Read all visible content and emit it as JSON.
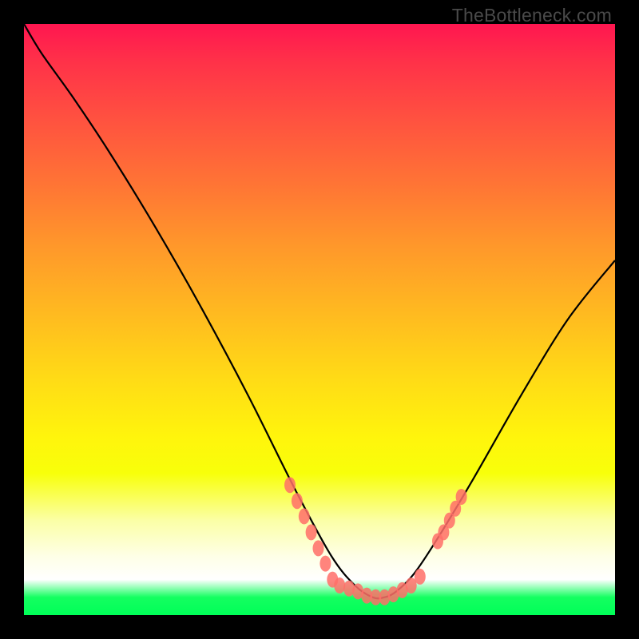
{
  "watermark_text": "TheBottleneck.com",
  "chart_data": {
    "type": "line",
    "title": "",
    "xlabel": "",
    "ylabel": "",
    "xlim": [
      0,
      100
    ],
    "ylim": [
      0,
      100
    ],
    "grid": false,
    "legend": false,
    "series": [
      {
        "name": "bottleneck-curve",
        "color": "#000000",
        "x": [
          0,
          3,
          8,
          14,
          22,
          30,
          38,
          46,
          52,
          56,
          59,
          61,
          63,
          66,
          70,
          76,
          84,
          92,
          100
        ],
        "y": [
          100,
          95,
          88,
          79,
          66,
          52,
          37,
          21,
          10,
          5,
          3,
          3,
          4,
          7,
          13,
          23,
          37,
          50,
          60
        ]
      },
      {
        "name": "marker-cluster-left",
        "type": "scatter",
        "color": "#ff6f69",
        "x": [
          45.0,
          46.2,
          47.4,
          48.6,
          49.8,
          51.0,
          52.2,
          53.4
        ],
        "y": [
          22.0,
          19.3,
          16.7,
          14.0,
          11.3,
          8.7,
          6.0,
          5.0
        ]
      },
      {
        "name": "marker-cluster-bottom",
        "type": "scatter",
        "color": "#ff6f69",
        "x": [
          55.0,
          56.5,
          58.0,
          59.5,
          61.0,
          62.5,
          64.0,
          65.5,
          67.0
        ],
        "y": [
          4.5,
          4.0,
          3.3,
          3.0,
          3.0,
          3.5,
          4.2,
          5.0,
          6.5
        ]
      },
      {
        "name": "marker-cluster-right",
        "type": "scatter",
        "color": "#ff6f69",
        "x": [
          70.0,
          71.0,
          72.0,
          73.0,
          74.0
        ],
        "y": [
          12.5,
          14.0,
          16.0,
          18.0,
          20.0
        ]
      }
    ],
    "background_gradient": {
      "direction": "top-to-bottom",
      "stops": [
        {
          "pos": 0.0,
          "color": "#ff1650"
        },
        {
          "pos": 0.5,
          "color": "#ffbd1f"
        },
        {
          "pos": 0.76,
          "color": "#f8ff0a"
        },
        {
          "pos": 0.94,
          "color": "#ffffff"
        },
        {
          "pos": 1.0,
          "color": "#00ff58"
        }
      ]
    }
  }
}
